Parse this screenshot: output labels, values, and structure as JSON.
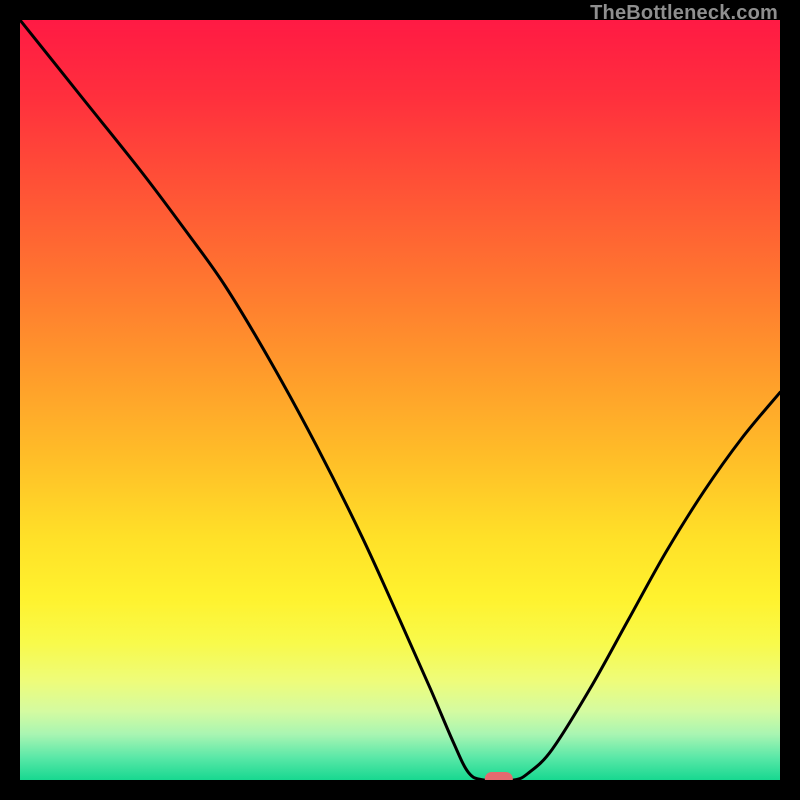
{
  "watermark": "TheBottleneck.com",
  "chart_data": {
    "type": "line",
    "title": "",
    "xlabel": "",
    "ylabel": "",
    "x_range": [
      0,
      100
    ],
    "y_range": [
      0,
      100
    ],
    "curve": [
      {
        "x": 0,
        "y": 100
      },
      {
        "x": 8,
        "y": 90
      },
      {
        "x": 16,
        "y": 80
      },
      {
        "x": 22,
        "y": 72
      },
      {
        "x": 27,
        "y": 65
      },
      {
        "x": 33,
        "y": 55
      },
      {
        "x": 39,
        "y": 44
      },
      {
        "x": 45,
        "y": 32
      },
      {
        "x": 50,
        "y": 21
      },
      {
        "x": 54,
        "y": 12
      },
      {
        "x": 57,
        "y": 5
      },
      {
        "x": 59,
        "y": 1
      },
      {
        "x": 61,
        "y": 0
      },
      {
        "x": 65,
        "y": 0
      },
      {
        "x": 67,
        "y": 1
      },
      {
        "x": 70,
        "y": 4
      },
      {
        "x": 75,
        "y": 12
      },
      {
        "x": 80,
        "y": 21
      },
      {
        "x": 85,
        "y": 30
      },
      {
        "x": 90,
        "y": 38
      },
      {
        "x": 95,
        "y": 45
      },
      {
        "x": 100,
        "y": 51
      }
    ],
    "optimal_marker": {
      "x": 63,
      "y": 0
    },
    "gradient_stops": [
      {
        "offset": 0.0,
        "color": "#ff1a44"
      },
      {
        "offset": 0.1,
        "color": "#ff2f3d"
      },
      {
        "offset": 0.22,
        "color": "#ff5236"
      },
      {
        "offset": 0.34,
        "color": "#ff7530"
      },
      {
        "offset": 0.46,
        "color": "#ff9a2b"
      },
      {
        "offset": 0.58,
        "color": "#ffbf28"
      },
      {
        "offset": 0.68,
        "color": "#ffe028"
      },
      {
        "offset": 0.76,
        "color": "#fff22e"
      },
      {
        "offset": 0.82,
        "color": "#f8fa4b"
      },
      {
        "offset": 0.87,
        "color": "#eefc7a"
      },
      {
        "offset": 0.91,
        "color": "#d4fba1"
      },
      {
        "offset": 0.94,
        "color": "#a8f5b2"
      },
      {
        "offset": 0.97,
        "color": "#5be8a8"
      },
      {
        "offset": 1.0,
        "color": "#17d890"
      }
    ],
    "marker_color": "#e46a6f",
    "line_color": "#000000"
  }
}
